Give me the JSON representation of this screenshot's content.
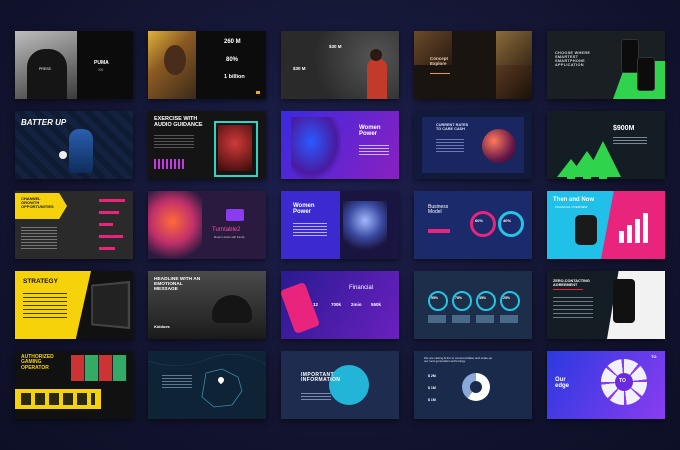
{
  "slides": [
    {
      "row": 1,
      "col": 1,
      "type": "photo",
      "brand": "PUMA",
      "stats": "000",
      "top_caption": "PRESS"
    },
    {
      "row": 1,
      "col": 2,
      "type": "photo-stats",
      "stat1": "260 M",
      "stat2": "80%",
      "stat3": "1 billion"
    },
    {
      "row": 1,
      "col": 3,
      "type": "chalk",
      "stat1": "$30 M",
      "stat2": "$30 M"
    },
    {
      "row": 1,
      "col": 4,
      "type": "photo",
      "title": "Concept\nExplore"
    },
    {
      "row": 1,
      "col": 5,
      "type": "app",
      "title": "CHOOSE WHERE\nSMARTEST\nSMARTPHONE\nAPPLICATION"
    },
    {
      "row": 2,
      "col": 1,
      "type": "sport",
      "title": "BATTER UP"
    },
    {
      "row": 2,
      "col": 2,
      "type": "fitness",
      "title": "EXERCISE WITH\nAUDIO GUIDANCE"
    },
    {
      "row": 2,
      "col": 3,
      "type": "portrait",
      "title": "Women\nPower"
    },
    {
      "row": 2,
      "col": 4,
      "type": "planet",
      "title": "CURRENT RATES\nTO CARE CASH"
    },
    {
      "row": 2,
      "col": 5,
      "type": "arrows",
      "title": "$900M"
    },
    {
      "row": 3,
      "col": 1,
      "type": "bars",
      "title": "CHANNEL\nGROWTH\nOPPORTUNITIES"
    },
    {
      "row": 3,
      "col": 2,
      "type": "music",
      "title": "Turntable2",
      "subtitle": "Music is better with friends"
    },
    {
      "row": 3,
      "col": 3,
      "type": "robot",
      "title": "Women\nPower"
    },
    {
      "row": 3,
      "col": 4,
      "type": "rings",
      "title": "Business\nModel",
      "stat1": "60%",
      "stat2": "40%"
    },
    {
      "row": 3,
      "col": 5,
      "type": "watch",
      "title": "Then and Now",
      "subtitle": "FINANCIAL OVERVIEW"
    },
    {
      "row": 4,
      "col": 1,
      "type": "strategy",
      "title": "STRATEGY"
    },
    {
      "row": 4,
      "col": 2,
      "type": "headline",
      "title": "HEADLINE WITH AN\nEMOTIONAL\nMESSAGE",
      "brand": "Kiddoes"
    },
    {
      "row": 4,
      "col": 3,
      "type": "financial",
      "title": "Financial",
      "stat1": "12",
      "stat2": "700k",
      "stat3": "2mio",
      "stat4": "550k"
    },
    {
      "row": 4,
      "col": 4,
      "type": "percent-rings",
      "stat1": "55%",
      "stat2": "75%",
      "stat3": "35%",
      "stat4": "25%"
    },
    {
      "row": 4,
      "col": 5,
      "type": "phone",
      "title": "ZERO-CONTACTING\nAGREEMENT"
    },
    {
      "row": 5,
      "col": 1,
      "type": "gaming",
      "title": "AUTHORIZED\nGAMING\nOPERATOR"
    },
    {
      "row": 5,
      "col": 2,
      "type": "map"
    },
    {
      "row": 5,
      "col": 3,
      "type": "info",
      "title": "IMPORTANT\nINFORMATION"
    },
    {
      "row": 5,
      "col": 4,
      "type": "donut",
      "title": "We are raising $ 3m to commercialise and scale-up\nour next generation technology",
      "stat1": "$ 2M",
      "stat2": "$ 1M",
      "stat3": "$ 1M"
    },
    {
      "row": 5,
      "col": 5,
      "type": "edge",
      "title": "Our\nedge",
      "logo": "TO",
      "badge": "TO"
    }
  ],
  "colors": {
    "accent_yellow": "#f5d20a",
    "accent_magenta": "#e8247c",
    "accent_cyan": "#23c4e6",
    "accent_green": "#2fd44c",
    "accent_purple": "#8a3cf0"
  }
}
